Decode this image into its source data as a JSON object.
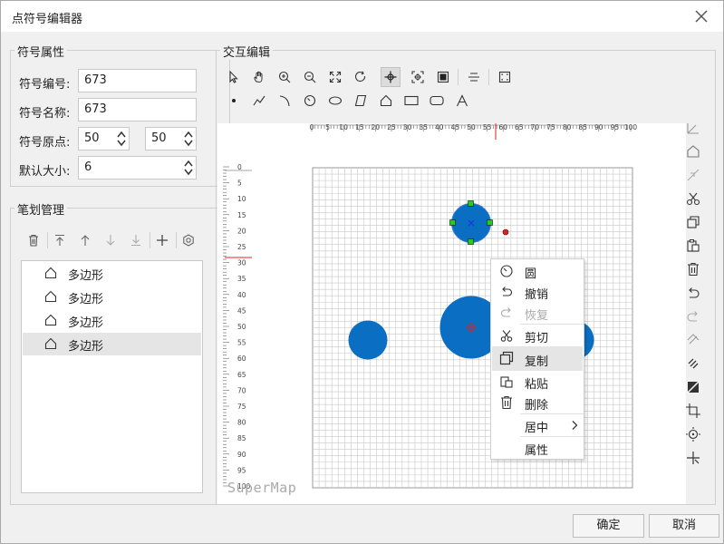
{
  "window": {
    "title": "点符号编辑器"
  },
  "symbol_props": {
    "group_title": "符号属性",
    "id_label": "符号编号:",
    "id_value": "673",
    "name_label": "符号名称:",
    "name_value": "673",
    "origin_label": "符号原点:",
    "origin_x": "50",
    "origin_y": "50",
    "size_label": "默认大小:",
    "size_value": "6"
  },
  "stroke_mgmt": {
    "group_title": "笔划管理",
    "items": [
      {
        "label": "多边形"
      },
      {
        "label": "多边形"
      },
      {
        "label": "多边形"
      },
      {
        "label": "多边形"
      }
    ],
    "selected_index": 3
  },
  "editor": {
    "group_title": "交互编辑",
    "h_ruler_ticks": [
      "0",
      "5",
      "10",
      "15",
      "20",
      "25",
      "30",
      "35",
      "40",
      "45",
      "50",
      "55",
      "60",
      "65",
      "70",
      "75",
      "80",
      "85",
      "90",
      "95",
      "100"
    ],
    "v_ruler_ticks": [
      "0",
      "5",
      "10",
      "15",
      "20",
      "25",
      "30",
      "35",
      "40",
      "45",
      "50",
      "55",
      "60",
      "65",
      "70",
      "75",
      "80",
      "85",
      "90",
      "95",
      "100"
    ],
    "watermark": "SuperMap"
  },
  "context_menu": {
    "items": [
      {
        "label": "圆",
        "icon": "circle-tool-icon",
        "disabled": false
      },
      {
        "label": "撤销",
        "icon": "undo-icon",
        "disabled": false
      },
      {
        "label": "恢复",
        "icon": "redo-icon",
        "disabled": true
      },
      {
        "label": "剪切",
        "icon": "scissors-icon",
        "disabled": false
      },
      {
        "label": "复制",
        "icon": "copy-icon",
        "disabled": false
      },
      {
        "label": "粘贴",
        "icon": "paste-icon",
        "disabled": false
      },
      {
        "label": "删除",
        "icon": "trash-icon",
        "disabled": false
      },
      {
        "label": "居中",
        "icon": "",
        "disabled": false
      },
      {
        "label": "属性",
        "icon": "",
        "disabled": false
      }
    ],
    "hover_index": 4
  },
  "footer": {
    "ok_label": "确定",
    "cancel_label": "取消"
  },
  "colors": {
    "shape_fill": "#0a6fc2",
    "selection_handle": "#22cc22",
    "origin_marker": "#e02020"
  }
}
